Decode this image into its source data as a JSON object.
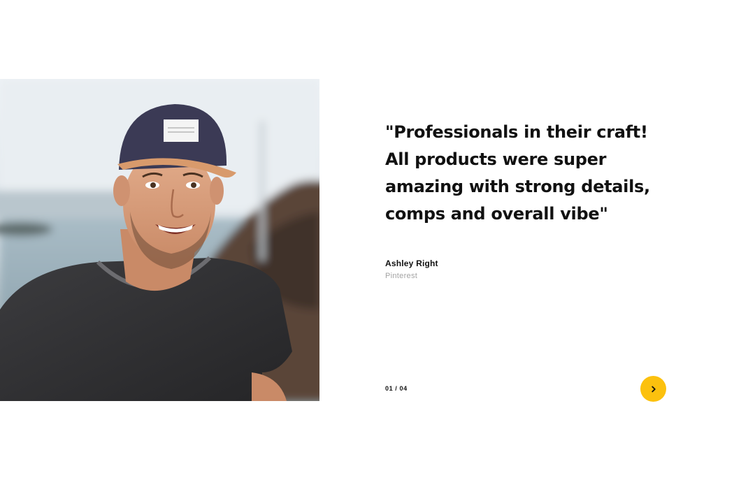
{
  "testimonial": {
    "quote": "\"Professionals in their craft! All products were super amazing with strong details, comps and overall vibe\"",
    "author_name": "Ashley Right",
    "author_company": "Pinterest",
    "photo_alt": "Smiling man wearing a cap"
  },
  "pagination": {
    "counter": "01 / 04"
  },
  "icons": {
    "next": "chevron-right-icon"
  },
  "colors": {
    "accent": "#fcc10e",
    "text": "#111111",
    "muted": "#a3a3a3"
  }
}
